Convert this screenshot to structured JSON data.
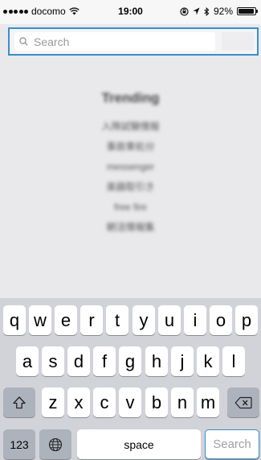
{
  "status_bar": {
    "carrier": "docomo",
    "time": "19:00",
    "battery_percent": "92%",
    "battery_level": 0.92
  },
  "search": {
    "placeholder": "Search"
  },
  "trending": {
    "title": "Trending",
    "items": [
      "入隊試験情報",
      "事故車処分",
      "messenger",
      "楽器取引き",
      "free fire",
      "朝活情報集"
    ]
  },
  "keyboard": {
    "row1": [
      "q",
      "w",
      "e",
      "r",
      "t",
      "y",
      "u",
      "i",
      "o",
      "p"
    ],
    "row2": [
      "a",
      "s",
      "d",
      "f",
      "g",
      "h",
      "j",
      "k",
      "l"
    ],
    "row3": [
      "z",
      "x",
      "c",
      "v",
      "b",
      "n",
      "m"
    ],
    "numbers_label": "123",
    "space_label": "space",
    "search_label": "Search"
  },
  "colors": {
    "accent": "#3a8fc8",
    "keyboard_bg": "#d1d3d9"
  }
}
